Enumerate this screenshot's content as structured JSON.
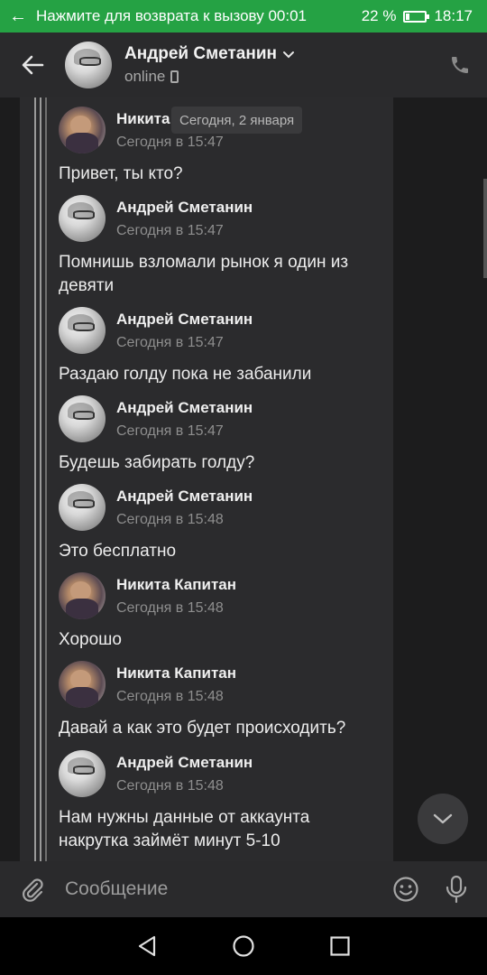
{
  "status_bar": {
    "call_banner": "Нажмите для возврата к вызову",
    "call_timer": "00:01",
    "battery_percent": "22 %",
    "battery_level": 0.22,
    "clock": "18:17"
  },
  "header": {
    "contact_name": "Андрей Сметанин",
    "status": "online"
  },
  "date_tooltip": "Сегодня, 2 января",
  "messages": [
    {
      "author": "Никита",
      "time": "Сегодня в 15:47",
      "text": "Привет, ты кто?",
      "avatar": "nikita"
    },
    {
      "author": "Андрей Сметанин",
      "time": "Сегодня в 15:47",
      "text": "Помнишь взломали рынок я один из девяти",
      "avatar": "andrey"
    },
    {
      "author": "Андрей Сметанин",
      "time": "Сегодня в 15:47",
      "text": "Раздаю голду пока не забанили",
      "avatar": "andrey"
    },
    {
      "author": "Андрей Сметанин",
      "time": "Сегодня в 15:47",
      "text": "Будешь забирать голду?",
      "avatar": "andrey"
    },
    {
      "author": "Андрей Сметанин",
      "time": "Сегодня в 15:48",
      "text": "Это бесплатно",
      "avatar": "andrey"
    },
    {
      "author": "Никита Капитан",
      "time": "Сегодня в 15:48",
      "text": "Хорошо",
      "avatar": "nikita"
    },
    {
      "author": "Никита Капитан",
      "time": "Сегодня в 15:48",
      "text": "Давай а как это будет происходить?",
      "avatar": "nikita"
    },
    {
      "author": "Андрей Сметанин",
      "time": "Сегодня в 15:48",
      "text": "Нам нужны данные от аккаунта накрутка займёт минут 5-10",
      "avatar": "andrey"
    }
  ],
  "composer": {
    "placeholder": "Сообщение"
  },
  "colors": {
    "status_bar_bg": "#25a244",
    "header_bg": "#2a2a2c",
    "chat_bg": "#1c1c1d"
  },
  "icons": {
    "status_back": "arrow-left-icon",
    "header_back": "arrow-left-icon",
    "call": "phone-icon",
    "attach": "paperclip-icon",
    "emoji": "smiley-icon",
    "mic": "microphone-icon",
    "scroll_down": "chevron-down-icon",
    "nav_back": "triangle-back-icon",
    "nav_home": "circle-home-icon",
    "nav_recents": "square-recents-icon"
  }
}
